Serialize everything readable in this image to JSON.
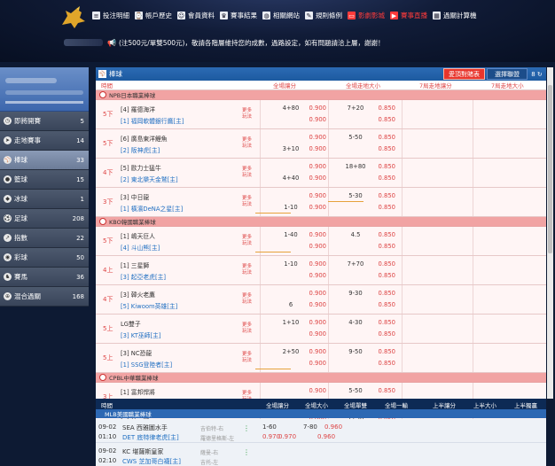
{
  "nav": [
    {
      "label": "投注明細",
      "icon": "list-icon"
    },
    {
      "label": "帳戶歷史",
      "icon": "history-icon"
    },
    {
      "label": "會員資料",
      "icon": "user-icon"
    },
    {
      "label": "賽事結果",
      "icon": "trophy-icon"
    },
    {
      "label": "相關網站",
      "icon": "globe-icon"
    },
    {
      "label": "規則條例",
      "icon": "pen-icon"
    },
    {
      "label": "影劇影城",
      "icon": "tv-icon",
      "highlight": true
    },
    {
      "label": "賽事直播",
      "icon": "live-icon",
      "highlight": true
    },
    {
      "label": "過關計算機",
      "icon": "calculator-icon"
    }
  ],
  "notice": "(注500元/單雙500元)，敬請各階層維持您的成數，過路設定，如有問題請洽上層，謝謝！",
  "sidebar": [
    {
      "label": "即將開賽",
      "count": "5",
      "icon": "clock-icon"
    },
    {
      "label": "走地賽事",
      "count": "14",
      "icon": "running-icon"
    },
    {
      "label": "棒球",
      "count": "33",
      "icon": "baseball-icon",
      "active": true
    },
    {
      "label": "籃球",
      "count": "15",
      "icon": "basketball-icon"
    },
    {
      "label": "冰球",
      "count": "1",
      "icon": "hockey-icon"
    },
    {
      "label": "足球",
      "count": "208",
      "icon": "soccer-icon"
    },
    {
      "label": "指數",
      "count": "22",
      "icon": "chart-icon"
    },
    {
      "label": "彩球",
      "count": "50",
      "icon": "lottery-icon"
    },
    {
      "label": "賽馬",
      "count": "36",
      "icon": "horse-icon"
    },
    {
      "label": "混合過關",
      "count": "168",
      "icon": "parlay-icon"
    }
  ],
  "main": {
    "sport": "棒球",
    "btn_red": "愛頂對賭表",
    "btn_blue": "選擇聯盟",
    "refresh": "8"
  },
  "colhead": {
    "time": "時間",
    "hcap": "全場讓分",
    "ou": "全場走地大小",
    "seven_hcap": "7局走地讓分",
    "seven_ou": "7局走地大小"
  },
  "leagues": [
    {
      "name": "NPB日本職業棒球",
      "matches": [
        {
          "time": "5下",
          "t1": "[4] 羅德海洋",
          "t2": "[1] 福岡軟體銀行鷹[主]",
          "hcap_a": "4+80",
          "hcap_b": "",
          "o1": "0.900",
          "o2": "0.900",
          "ou_a": "7+20",
          "ou_b": "",
          "p1": "0.850",
          "p2": "0.850"
        },
        {
          "time": "5下",
          "t1": "[6] 廣島東洋鯉魚",
          "t2": "[2] 阪神虎[主]",
          "hcap_a": "",
          "hcap_b": "3+10",
          "o1": "0.900",
          "o2": "0.900",
          "ou_a": "5-50",
          "ou_b": "",
          "p1": "0.850",
          "p2": "0.850"
        },
        {
          "time": "4下",
          "t1": "[5] 歐力士猛牛",
          "t2": "[2] 東北樂天金鷲[主]",
          "hcap_a": "",
          "hcap_b": "4+40",
          "o1": "0.900",
          "o2": "0.900",
          "ou_a": "18+80",
          "ou_b": "",
          "p1": "0.850",
          "p2": "0.850"
        },
        {
          "time": "3下",
          "t1": "[3] 中日龍",
          "t2": "[1] 橫濱DeNA之星[主]",
          "hcap_a": "",
          "hcap_b": "1-10",
          "o1": "0.900",
          "o2": "0.900",
          "ou_a": "5-30",
          "ou_b": "",
          "p1": "0.850",
          "p2": "0.850"
        }
      ]
    },
    {
      "name": "KBO韓國職業棒球",
      "matches": [
        {
          "time": "5下",
          "t1": "[1] 嶋天巨人",
          "t2": "[4] 斗山熊[主]",
          "hcap_a": "1-40",
          "hcap_b": "",
          "o1": "0.900",
          "o2": "0.900",
          "ou_a": "4.5",
          "ou_b": "",
          "p1": "0.850",
          "p2": "0.850"
        },
        {
          "time": "4上",
          "t1": "[1] 三星獅",
          "t2": "[3] 起亞老虎[主]",
          "hcap_a": "1-10",
          "hcap_b": "",
          "o1": "0.900",
          "o2": "0.900",
          "ou_a": "7+70",
          "ou_b": "",
          "p1": "0.850",
          "p2": "0.850"
        },
        {
          "time": "4下",
          "t1": "[3] 韓火老鷹",
          "t2": "[5] Kiwoom英雄[主]",
          "hcap_a": "",
          "hcap_b": "6",
          "o1": "0.900",
          "o2": "0.900",
          "ou_a": "9-30",
          "ou_b": "",
          "p1": "0.850",
          "p2": "0.850"
        },
        {
          "time": "5上",
          "t1": "LG雙子",
          "t2": "[3] KT巫師[主]",
          "hcap_a": "1+10",
          "hcap_b": "",
          "o1": "0.900",
          "o2": "0.900",
          "ou_a": "4-30",
          "ou_b": "",
          "p1": "0.850",
          "p2": "0.850"
        },
        {
          "time": "5上",
          "t1": "[3] NC恐龍",
          "t2": "[1] SSG登陸者[主]",
          "hcap_a": "2+50",
          "hcap_b": "",
          "o1": "0.900",
          "o2": "0.900",
          "ou_a": "9-50",
          "ou_b": "",
          "p1": "0.850",
          "p2": "0.850"
        }
      ]
    },
    {
      "name": "CPBL中華職業棒球",
      "matches": [
        {
          "time": "3上",
          "t1": "[1] 富邦悍將",
          "t2": "[1] 味全龍[主]",
          "hcap_a": "",
          "hcap_b": "1+70",
          "o1": "0.900",
          "o2": "0.900",
          "ou_a": "5-50",
          "ou_b": "",
          "p1": "0.850",
          "p2": "0.850"
        },
        {
          "time": "1下",
          "t1": "[1] 統一獅",
          "t2": "[1] 中信兄弟[主]",
          "hcap_a": "",
          "hcap_b": "1-20",
          "o1": "0.900",
          "o2": "0.900",
          "ou_a": "7+20",
          "ou_b": "",
          "p1": "0.850",
          "p2": "0.850"
        }
      ]
    }
  ],
  "more_label": "更多玩法",
  "mlb": {
    "bar": {
      "time": "時間",
      "hcap": "全場讓分",
      "ou": "全場大小",
      "oe": "全場單雙",
      "win": "全場一輸",
      "h_hcap": "上半讓分",
      "h_ou": "上半大小",
      "h_win": "上半獨贏"
    },
    "league": "MLB美國職業棒球",
    "rows": [
      {
        "d1": "09-02",
        "d2": "01:10",
        "a1": "SEA 西雅圖水手",
        "a2": "DET 底特律老虎[主]",
        "pc1": "吉伯特-右",
        "pc2": "羅德里格斯-左",
        "h1": "1-60",
        "hv": "0.970",
        "h2": "0.970",
        "ou1": "7-80",
        "ouv": "0.960",
        "ou2": "0.960"
      },
      {
        "d1": "09-02",
        "d2": "02:10",
        "a1": "KC 堪薩斯皇家",
        "a2": "CWS 芝加哥白襪[主]",
        "pc1": "薩曼-右",
        "pc2": "吉托-左",
        "h1": "",
        "hv": "",
        "h2": "",
        "ou1": "",
        "ouv": "",
        "ou2": ""
      }
    ]
  }
}
